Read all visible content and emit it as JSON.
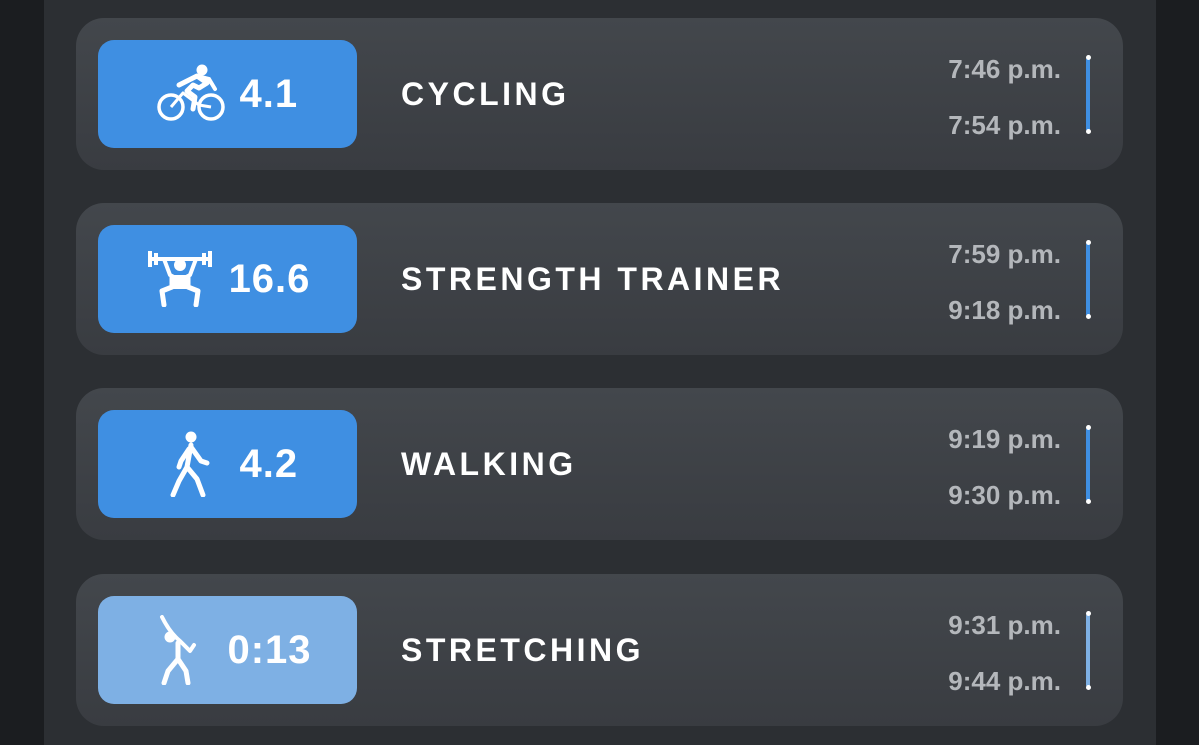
{
  "activities": [
    {
      "icon": "cycling-icon",
      "value": "4.1",
      "name": "CYCLING",
      "start": "7:46 p.m.",
      "end": "7:54 p.m."
    },
    {
      "icon": "weightlifting-icon",
      "value": "16.6",
      "name": "STRENGTH TRAINER",
      "start": "7:59 p.m.",
      "end": "9:18 p.m."
    },
    {
      "icon": "walking-icon",
      "value": "4.2",
      "name": "WALKING",
      "start": "9:19 p.m.",
      "end": "9:30 p.m."
    },
    {
      "icon": "stretching-icon",
      "value": "0:13",
      "name": "STRETCHING",
      "start": "9:31 p.m.",
      "end": "9:44 p.m."
    }
  ],
  "colors": {
    "accent": "#3f8fe2",
    "accent_light": "#7eb0e4",
    "card_bg": "#43474c",
    "panel_bg": "#2c2f33",
    "page_bg": "#1b1d20",
    "time_text": "#b4b7bb"
  }
}
